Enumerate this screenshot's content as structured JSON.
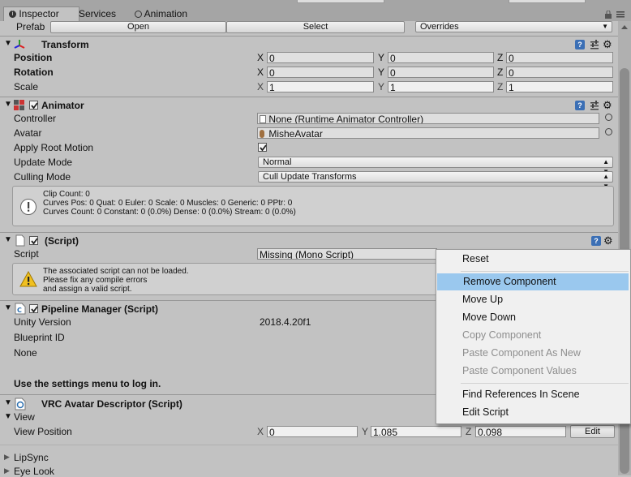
{
  "tabs": [
    {
      "label": "Inspector",
      "icon": "info-icon",
      "active": true
    },
    {
      "label": "Services",
      "icon": "",
      "active": false
    },
    {
      "label": "Animation",
      "icon": "clock-icon",
      "active": false
    }
  ],
  "prefab": {
    "label": "Prefab",
    "open": "Open",
    "select": "Select",
    "overrides": "Overrides"
  },
  "transform": {
    "title": "Transform",
    "position": {
      "label": "Position",
      "x": "0",
      "y": "0",
      "z": "0"
    },
    "rotation": {
      "label": "Rotation",
      "x": "0",
      "y": "0",
      "z": "0"
    },
    "scale": {
      "label": "Scale",
      "x": "1",
      "y": "1",
      "z": "1"
    },
    "axis": {
      "x": "X",
      "y": "Y",
      "z": "Z"
    }
  },
  "animator": {
    "title": "Animator",
    "controller_label": "Controller",
    "controller_value": "None (Runtime Animator Controller)",
    "avatar_label": "Avatar",
    "avatar_value": "MisheAvatar",
    "root_motion_label": "Apply Root Motion",
    "root_motion_checked": true,
    "update_mode_label": "Update Mode",
    "update_mode_value": "Normal",
    "culling_mode_label": "Culling Mode",
    "culling_mode_value": "Cull Update Transforms",
    "info": {
      "line1": "Clip Count: 0",
      "line2": "Curves Pos: 0 Quat: 0 Euler: 0 Scale: 0 Muscles: 0 Generic: 0 PPtr: 0",
      "line3": "Curves Count: 0 Constant: 0 (0.0%) Dense: 0 (0.0%) Stream: 0 (0.0%)"
    }
  },
  "script": {
    "title": "(Script)",
    "script_label": "Script",
    "script_value": "Missing (Mono Script)",
    "warning": {
      "line1": "The associated script can not be loaded.",
      "line2": "Please fix any compile errors",
      "line3": "and assign a valid script."
    }
  },
  "pipeline": {
    "title": "Pipeline Manager (Script)",
    "unity_version_label": "Unity Version",
    "unity_version_value": "2018.4.20f1",
    "blueprint_label": "Blueprint ID",
    "none_label": "None",
    "login_text": "Use the settings menu to log in."
  },
  "vrc": {
    "title": "VRC Avatar Descriptor (Script)",
    "view_label": "View",
    "view_position_label": "View Position",
    "x": "0",
    "y": "1.085",
    "z": "0.098",
    "edit": "Edit",
    "lipsync_label": "LipSync",
    "eyelook_label": "Eye Look"
  },
  "context_menu": {
    "items": [
      {
        "label": "Reset",
        "enabled": true,
        "highlighted": false
      },
      {
        "label": "Remove Component",
        "enabled": true,
        "highlighted": true
      },
      {
        "label": "Move Up",
        "enabled": true,
        "highlighted": false
      },
      {
        "label": "Move Down",
        "enabled": true,
        "highlighted": false
      },
      {
        "label": "Copy Component",
        "enabled": false,
        "highlighted": false
      },
      {
        "label": "Paste Component As New",
        "enabled": false,
        "highlighted": false
      },
      {
        "label": "Paste Component Values",
        "enabled": false,
        "highlighted": false
      },
      {
        "label": "Find References In Scene",
        "enabled": true,
        "highlighted": false
      },
      {
        "label": "Edit Script",
        "enabled": true,
        "highlighted": false
      }
    ]
  },
  "colors": {
    "highlight": "#9ac8ee",
    "panel": "#c2c2c2",
    "tabbar": "#a5a5a5"
  }
}
